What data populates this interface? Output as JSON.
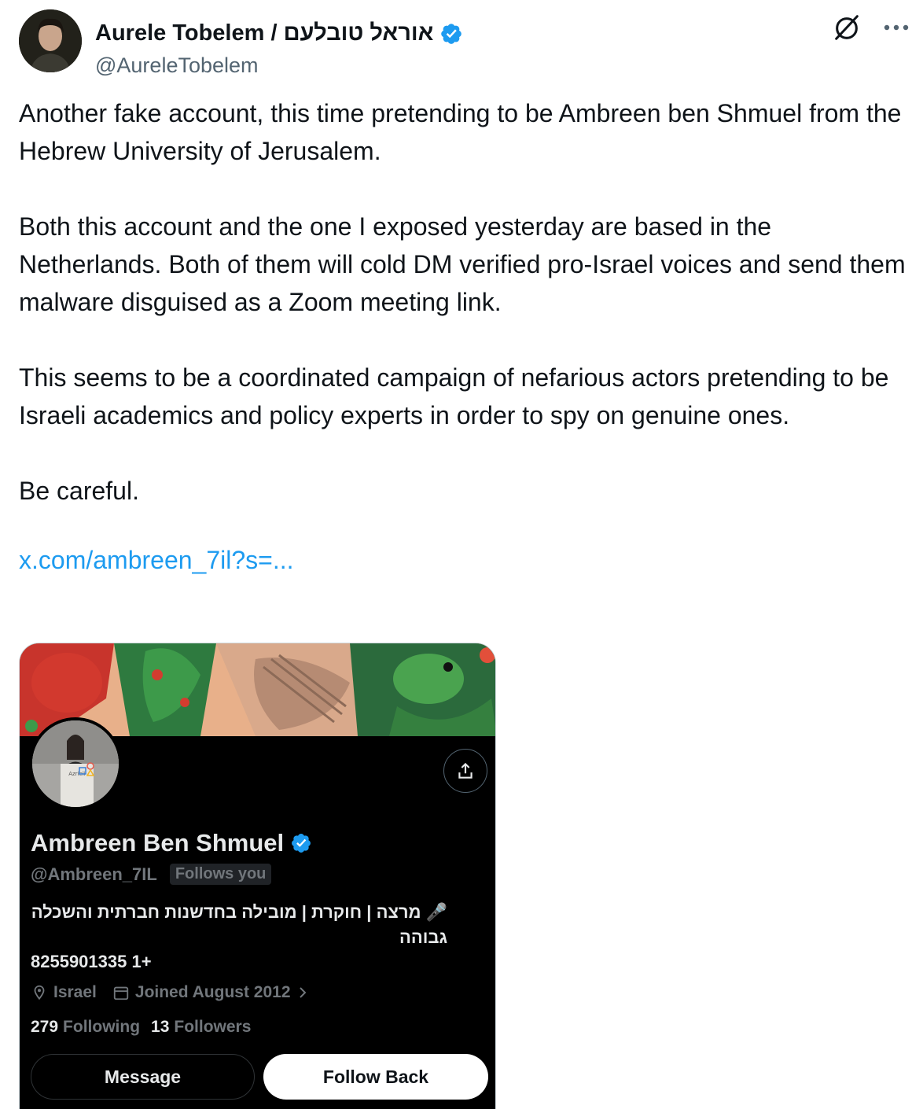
{
  "tweet": {
    "author_name": "Aurele Tobelem / אוראל טובלעם",
    "author_handle": "@AureleTobelem",
    "paragraphs": [
      "Another fake account, this time pretending to be Ambreen ben Shmuel from the Hebrew University of Jerusalem.",
      "Both this account and the one I exposed yesterday are based in the Netherlands. Both of them will cold DM verified pro-Israel voices and send them malware disguised as a Zoom meeting link.",
      "This seems to be a coordinated campaign of nefarious actors pretending to be Israeli academics and policy experts in order to spy on genuine ones.",
      "Be careful."
    ],
    "link_text": "x.com/ambreen_7il?s=..."
  },
  "profile_card": {
    "name": "Ambreen Ben Shmuel",
    "handle": "@Ambreen_7IL",
    "follows_you": "Follows you",
    "bio": "🎤 מרצה | חוקרת | מובילה בחדשנות חברתית והשכלה גבוהה",
    "phone": "8255901335 1+",
    "location": "Israel",
    "joined": "Joined August 2012",
    "following_count": "279",
    "following_label": "Following",
    "followers_count": "13",
    "followers_label": "Followers",
    "message_label": "Message",
    "follow_back_label": "Follow Back"
  },
  "icons": {
    "verified": "verified-badge-icon",
    "grok": "grok-icon",
    "more": "more-icon",
    "share": "share-icon",
    "location": "location-icon",
    "calendar": "calendar-icon",
    "chevron": "chevron-right-icon"
  },
  "colors": {
    "link": "#1d9bf0",
    "verified": "#1d9bf0",
    "secondary_text": "#536471"
  }
}
